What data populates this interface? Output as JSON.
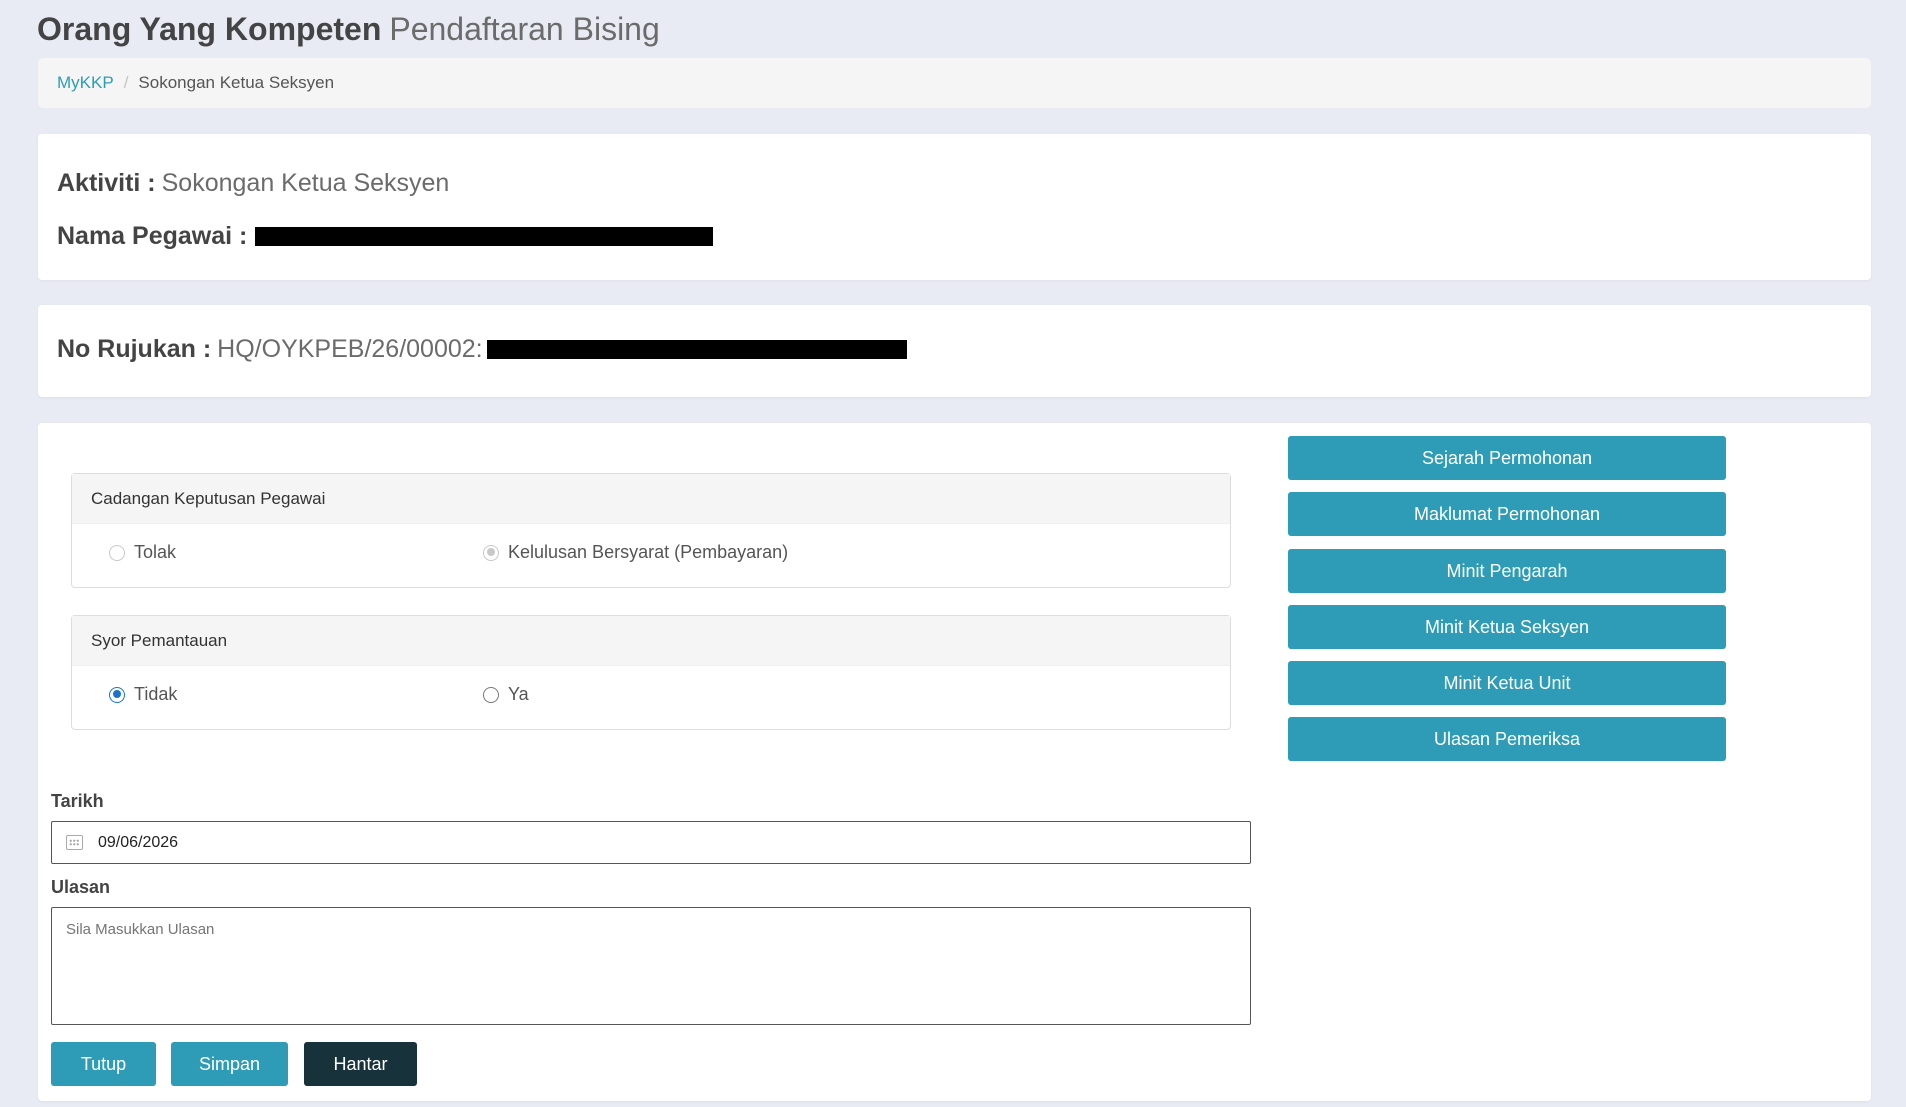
{
  "header": {
    "title_strong": "Orang Yang Kompeten",
    "title_light": "Pendaftaran Bising"
  },
  "breadcrumb": {
    "home": "MyKKP",
    "separator": "/",
    "current": "Sokongan Ketua Seksyen"
  },
  "info": {
    "aktiviti_label": "Aktiviti :",
    "aktiviti_value": "Sokongan Ketua Seksyen",
    "nama_label": "Nama Pegawai :",
    "rujukan_label": "No Rujukan :",
    "rujukan_value": "HQ/OYKPEB/26/00002:"
  },
  "cadangan": {
    "title": "Cadangan Keputusan Pegawai",
    "option_1": "Tolak",
    "option_2": "Kelulusan Bersyarat (Pembayaran)"
  },
  "syor": {
    "title": "Syor Pemantauan",
    "option_1": "Tidak",
    "option_2": "Ya"
  },
  "form": {
    "tarikh_label": "Tarikh",
    "tarikh_value": "09/06/2026",
    "ulasan_label": "Ulasan",
    "ulasan_placeholder": "Sila Masukkan Ulasan"
  },
  "actions": {
    "tutup": "Tutup",
    "simpan": "Simpan",
    "hantar": "Hantar"
  },
  "side_buttons": {
    "sejarah": "Sejarah Permohonan",
    "maklumat": "Maklumat Permohonan",
    "minit_pengarah": "Minit Pengarah",
    "minit_ketua_seksyen": "Minit Ketua Seksyen",
    "minit_ketua_unit": "Minit Ketua Unit",
    "ulasan_pemeriksa": "Ulasan Pemeriksa"
  },
  "colors": {
    "accent": "#2e9cb6",
    "dark_button": "#17323b",
    "background": "#e8ebf3",
    "radio_selected": "#1a73c9"
  }
}
